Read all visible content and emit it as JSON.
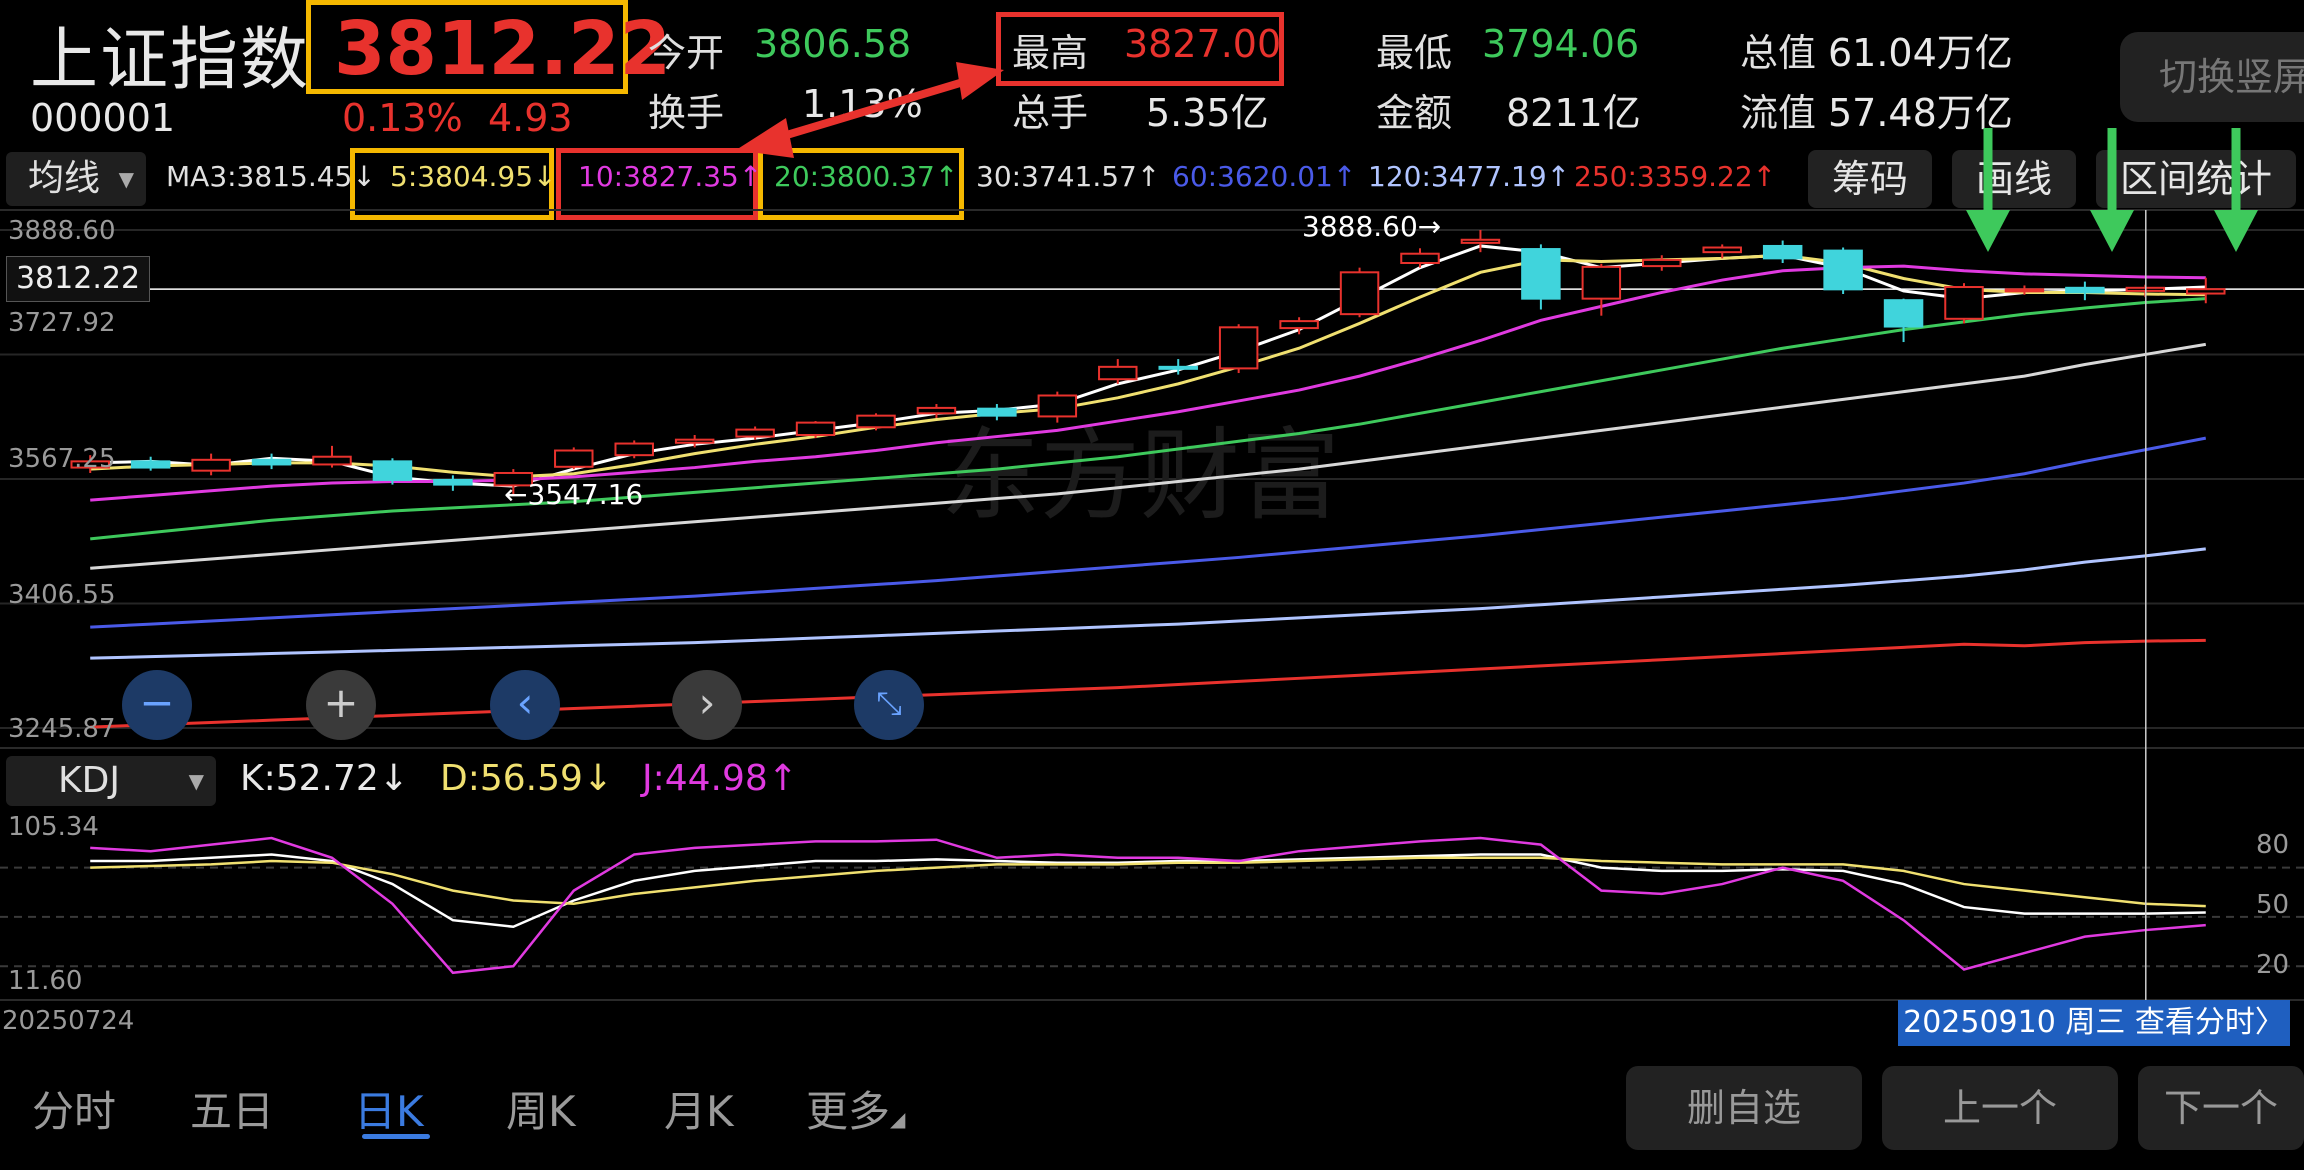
{
  "header": {
    "name": "上证指数",
    "code": "000001",
    "price": "3812.22",
    "change_pct": "0.13%",
    "change": "4.93",
    "open_label": "今开",
    "open": "3806.58",
    "high_label": "最高",
    "high": "3827.00",
    "low_label": "最低",
    "low": "3794.06",
    "total_mv_label": "总值",
    "total_mv": "61.04万亿",
    "turnover_label": "换手",
    "turnover": "1.13%",
    "volume_label": "总手",
    "volume": "5.35亿",
    "amount_label": "金额",
    "amount": "8211亿",
    "float_mv_label": "流值",
    "float_mv": "57.48万亿",
    "switch_button": "切换竖屏"
  },
  "ma_bar": {
    "selector": "均线",
    "items": [
      {
        "text": "MA3:3815.45↓",
        "color": "#e0e0e0"
      },
      {
        "text": "5:3804.95↓",
        "color": "#f0e070"
      },
      {
        "text": "10:3827.35↑",
        "color": "#e03ae0"
      },
      {
        "text": "20:3800.37↑",
        "color": "#3ec95c"
      },
      {
        "text": "30:3741.57↑",
        "color": "#e0e0e0"
      },
      {
        "text": "60:3620.01↑",
        "color": "#4a5ae8"
      },
      {
        "text": "120:3477.19↑",
        "color": "#b0c4ff"
      },
      {
        "text": "250:3359.22↑",
        "color": "#e8322d"
      }
    ],
    "buttons": [
      "筹码",
      "画线",
      "区间统计"
    ]
  },
  "chart": {
    "y_labels": [
      "3888.60",
      "3727.92",
      "3567.25",
      "3406.55",
      "3245.87"
    ],
    "current_price_label": "3812.22",
    "high_annotation": "3888.60→",
    "low_annotation": "←3547.16",
    "watermark": "东方财富"
  },
  "kdj": {
    "selector": "KDJ",
    "k": "K:52.72↓",
    "d": "D:56.59↓",
    "j": "J:44.98↑",
    "y_left": [
      "105.34",
      "11.60"
    ],
    "y_right": [
      "80",
      "50",
      "20"
    ],
    "start_date": "20250724",
    "date_tip": "20250910 周三 查看分时〉"
  },
  "tabs": [
    "分时",
    "五日",
    "日K",
    "周K",
    "月K",
    "更多"
  ],
  "bottom_buttons": [
    "删自选",
    "上一个",
    "下一个"
  ],
  "chart_data": {
    "type": "candlestick",
    "title": "上证指数",
    "start_date": "20250724",
    "end_date": "20250910",
    "ylim": [
      3245.87,
      3888.6
    ],
    "candles": [
      {
        "o": 3582,
        "c": 3590,
        "h": 3598,
        "l": 3575
      },
      {
        "o": 3590,
        "c": 3582,
        "h": 3596,
        "l": 3578
      },
      {
        "o": 3578,
        "c": 3592,
        "h": 3600,
        "l": 3572
      },
      {
        "o": 3592,
        "c": 3586,
        "h": 3600,
        "l": 3580
      },
      {
        "o": 3586,
        "c": 3596,
        "h": 3610,
        "l": 3582
      },
      {
        "o": 3590,
        "c": 3566,
        "h": 3594,
        "l": 3560
      },
      {
        "o": 3566,
        "c": 3560,
        "h": 3572,
        "l": 3552
      },
      {
        "o": 3559,
        "c": 3575,
        "h": 3580,
        "l": 3547.16
      },
      {
        "o": 3583,
        "c": 3604,
        "h": 3608,
        "l": 3580
      },
      {
        "o": 3598,
        "c": 3613,
        "h": 3617,
        "l": 3594
      },
      {
        "o": 3614,
        "c": 3618,
        "h": 3624,
        "l": 3608
      },
      {
        "o": 3622,
        "c": 3631,
        "h": 3635,
        "l": 3618
      },
      {
        "o": 3624,
        "c": 3640,
        "h": 3642,
        "l": 3620
      },
      {
        "o": 3634,
        "c": 3649,
        "h": 3652,
        "l": 3630
      },
      {
        "o": 3652,
        "c": 3659,
        "h": 3664,
        "l": 3646
      },
      {
        "o": 3658,
        "c": 3649,
        "h": 3664,
        "l": 3643
      },
      {
        "o": 3648,
        "c": 3675,
        "h": 3680,
        "l": 3640
      },
      {
        "o": 3696,
        "c": 3712,
        "h": 3722,
        "l": 3690
      },
      {
        "o": 3712,
        "c": 3710,
        "h": 3722,
        "l": 3702
      },
      {
        "o": 3710,
        "c": 3763,
        "h": 3767,
        "l": 3704
      },
      {
        "o": 3762,
        "c": 3771,
        "h": 3776,
        "l": 3754
      },
      {
        "o": 3780,
        "c": 3834,
        "h": 3840,
        "l": 3776
      },
      {
        "o": 3846,
        "c": 3858,
        "h": 3865,
        "l": 3840
      },
      {
        "o": 3872,
        "c": 3876,
        "h": 3888.6,
        "l": 3860
      },
      {
        "o": 3864,
        "c": 3800,
        "h": 3870,
        "l": 3786
      },
      {
        "o": 3800,
        "c": 3841,
        "h": 3845,
        "l": 3778
      },
      {
        "o": 3842,
        "c": 3850,
        "h": 3856,
        "l": 3836
      },
      {
        "o": 3860,
        "c": 3866,
        "h": 3870,
        "l": 3852
      },
      {
        "o": 3868,
        "c": 3852,
        "h": 3875,
        "l": 3846
      },
      {
        "o": 3862,
        "c": 3812,
        "h": 3866,
        "l": 3806
      },
      {
        "o": 3798,
        "c": 3764,
        "h": 3800,
        "l": 3744
      },
      {
        "o": 3774,
        "c": 3815,
        "h": 3820,
        "l": 3768
      },
      {
        "o": 3812,
        "c": 3812,
        "h": 3817,
        "l": 3805
      },
      {
        "o": 3814,
        "c": 3808,
        "h": 3822,
        "l": 3798
      },
      {
        "o": 3810,
        "c": 3814,
        "h": 3818,
        "l": 3802
      },
      {
        "o": 3806.58,
        "c": 3812.22,
        "h": 3827.0,
        "l": 3794.06
      }
    ],
    "ma_lines": [
      {
        "name": "MA3",
        "color": "#ffffff",
        "values": [
          3588,
          3590,
          3585,
          3594,
          3590,
          3570,
          3562,
          3558,
          3580,
          3600,
          3612,
          3620,
          3630,
          3640,
          3652,
          3656,
          3664,
          3690,
          3708,
          3732,
          3760,
          3800,
          3840,
          3868,
          3860,
          3840,
          3846,
          3852,
          3856,
          3840,
          3810,
          3800,
          3808,
          3810,
          3812,
          3815
        ]
      },
      {
        "name": "MA5",
        "color": "#f0e070",
        "values": [
          3580,
          3584,
          3586,
          3588,
          3588,
          3584,
          3576,
          3570,
          3574,
          3586,
          3600,
          3612,
          3622,
          3634,
          3644,
          3652,
          3658,
          3672,
          3690,
          3712,
          3736,
          3768,
          3802,
          3834,
          3850,
          3848,
          3850,
          3852,
          3856,
          3846,
          3826,
          3812,
          3808,
          3808,
          3806,
          3805
        ]
      },
      {
        "name": "MA10",
        "color": "#e03ae0",
        "values": [
          3540,
          3546,
          3552,
          3558,
          3562,
          3564,
          3564,
          3566,
          3570,
          3576,
          3582,
          3590,
          3596,
          3604,
          3614,
          3622,
          3630,
          3642,
          3654,
          3668,
          3682,
          3700,
          3722,
          3746,
          3772,
          3790,
          3808,
          3824,
          3836,
          3840,
          3842,
          3836,
          3832,
          3830,
          3828,
          3827
        ]
      },
      {
        "name": "MA20",
        "color": "#3ec95c",
        "values": [
          3490,
          3498,
          3506,
          3514,
          3520,
          3526,
          3530,
          3534,
          3538,
          3544,
          3550,
          3556,
          3562,
          3568,
          3574,
          3580,
          3588,
          3596,
          3606,
          3616,
          3626,
          3638,
          3652,
          3666,
          3680,
          3694,
          3708,
          3722,
          3736,
          3748,
          3760,
          3770,
          3780,
          3788,
          3795,
          3800
        ]
      },
      {
        "name": "MA30",
        "color": "#d8d8d8",
        "values": [
          3452,
          3458,
          3464,
          3470,
          3476,
          3482,
          3488,
          3494,
          3500,
          3506,
          3512,
          3518,
          3524,
          3530,
          3536,
          3542,
          3548,
          3556,
          3564,
          3572,
          3580,
          3590,
          3600,
          3610,
          3620,
          3630,
          3640,
          3650,
          3660,
          3670,
          3680,
          3690,
          3700,
          3715,
          3728,
          3741
        ]
      },
      {
        "name": "MA60",
        "color": "#4a5ae8",
        "values": [
          3376,
          3380,
          3384,
          3388,
          3392,
          3396,
          3400,
          3404,
          3408,
          3412,
          3416,
          3421,
          3426,
          3431,
          3436,
          3442,
          3448,
          3454,
          3460,
          3466,
          3473,
          3480,
          3487,
          3494,
          3502,
          3510,
          3518,
          3526,
          3534,
          3542,
          3552,
          3562,
          3574,
          3590,
          3605,
          3620
        ]
      },
      {
        "name": "MA120",
        "color": "#b0c4ff",
        "values": [
          3336,
          3338,
          3340,
          3342,
          3344,
          3346,
          3348,
          3350,
          3352,
          3354,
          3356,
          3359,
          3362,
          3365,
          3368,
          3371,
          3374,
          3377,
          3380,
          3384,
          3388,
          3392,
          3396,
          3400,
          3405,
          3410,
          3415,
          3420,
          3425,
          3430,
          3436,
          3442,
          3450,
          3460,
          3468,
          3477
        ]
      },
      {
        "name": "MA250",
        "color": "#e8322d",
        "values": [
          3247,
          3250,
          3253,
          3256,
          3259,
          3262,
          3265,
          3268,
          3271,
          3274,
          3277,
          3280,
          3283,
          3286,
          3289,
          3292,
          3295,
          3298,
          3302,
          3306,
          3310,
          3314,
          3318,
          3322,
          3326,
          3330,
          3334,
          3338,
          3342,
          3346,
          3350,
          3354,
          3352,
          3356,
          3358,
          3359
        ]
      }
    ],
    "kdj": {
      "ylim": [
        11.6,
        105.34
      ],
      "K": [
        84,
        84,
        86,
        88,
        84,
        70,
        48,
        44,
        60,
        72,
        78,
        81,
        84,
        84,
        85,
        84,
        83,
        83,
        84,
        84,
        85,
        86,
        87,
        88,
        88,
        80,
        78,
        78,
        79,
        78,
        70,
        56,
        52,
        52,
        52,
        52.72
      ],
      "D": [
        80,
        81,
        82,
        84,
        83,
        76,
        66,
        60,
        58,
        64,
        68,
        72,
        75,
        78,
        80,
        82,
        82,
        82,
        83,
        83,
        84,
        85,
        86,
        86,
        86,
        84,
        83,
        82,
        82,
        82,
        78,
        70,
        66,
        62,
        58,
        56.59
      ],
      "J": [
        92,
        90,
        94,
        98,
        86,
        58,
        16,
        20,
        66,
        88,
        92,
        94,
        96,
        96,
        97,
        86,
        88,
        86,
        86,
        84,
        90,
        93,
        96,
        98,
        94,
        66,
        64,
        70,
        80,
        72,
        48,
        18,
        28,
        38,
        42,
        44.98
      ]
    }
  }
}
